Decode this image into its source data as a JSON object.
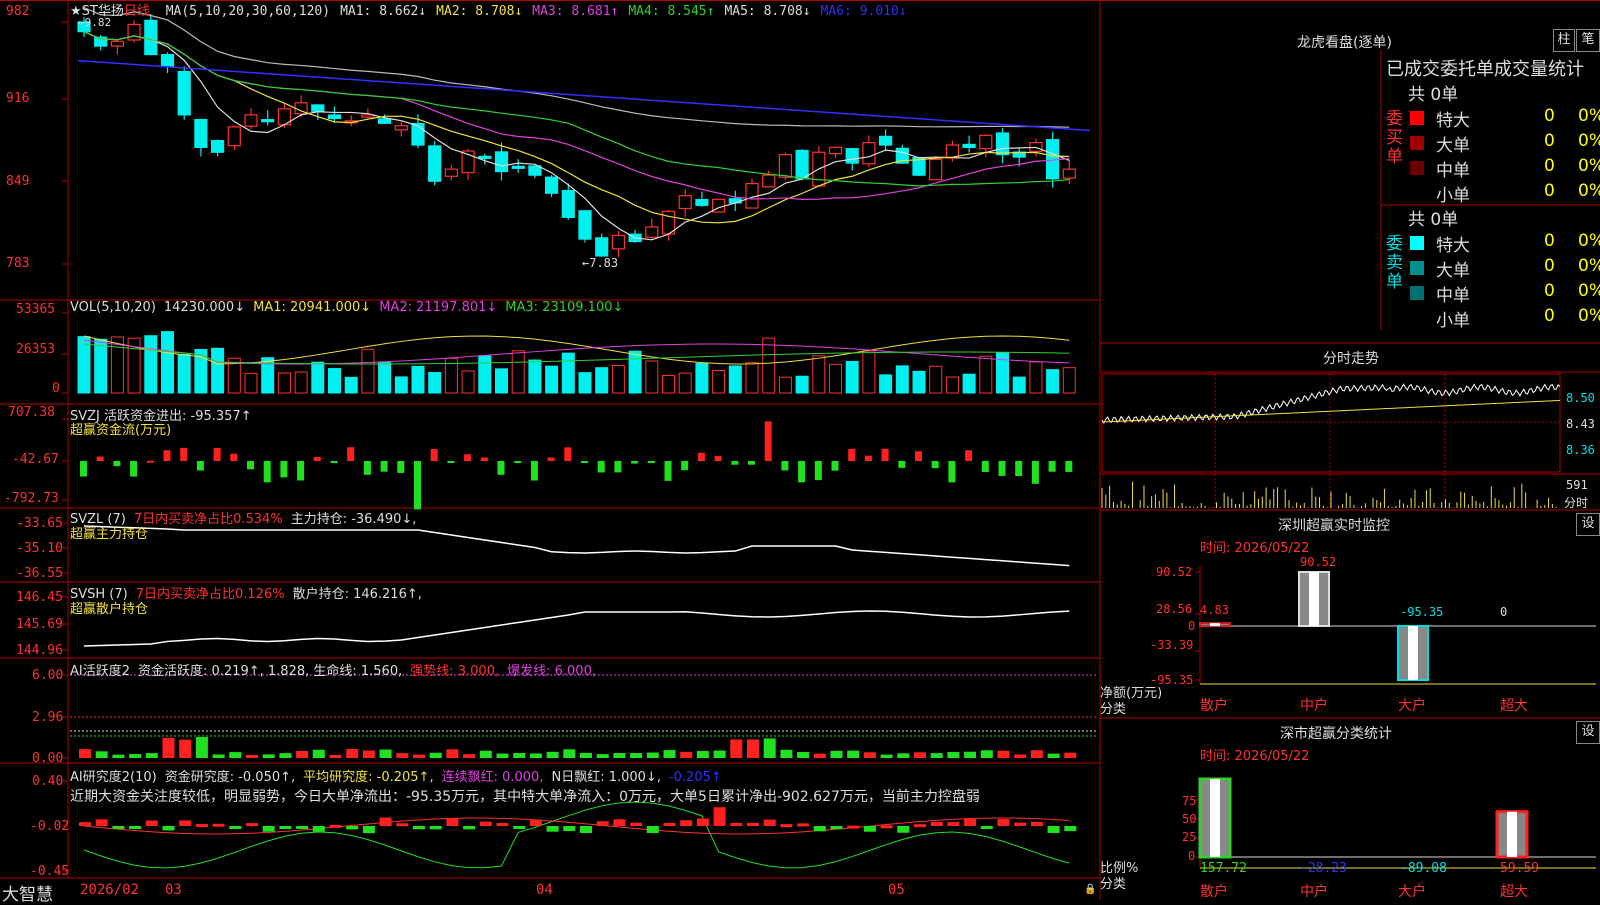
{
  "stock": {
    "name": "★ST华扬",
    "period": "日线"
  },
  "main": {
    "ma_labels": [
      {
        "text": "MA(5,10,20,30,60,120)",
        "color": "#dddddd"
      },
      {
        "text": "MA1: 8.662↓",
        "color": "#dddddd"
      },
      {
        "text": "MA2: 8.708↓",
        "color": "#f0e040"
      },
      {
        "text": "MA3: 8.681↑",
        "color": "#e040e0"
      },
      {
        "text": "MA4: 8.545↑",
        "color": "#30d030"
      },
      {
        "text": "MA5: 8.708↓",
        "color": "#dddddd"
      },
      {
        "text": "MA6: 9.010↓",
        "color": "#3030ff"
      }
    ],
    "y_ticks": [
      "982",
      "916",
      "849",
      "783"
    ],
    "high_label": "9.82",
    "low_label": "7.83"
  },
  "vol": {
    "labels": [
      {
        "text": "VOL(5,10,20)",
        "color": "#dddddd"
      },
      {
        "text": "14230.000↓",
        "color": "#dddddd"
      },
      {
        "text": "MA1: 20941.000↓",
        "color": "#f0e040"
      },
      {
        "text": "MA2: 21197.801↓",
        "color": "#e040e0"
      },
      {
        "text": "MA3: 23109.100↓",
        "color": "#30d030"
      }
    ],
    "y_ticks": [
      "53365",
      "26353",
      "0"
    ]
  },
  "svzj": {
    "labels": [
      {
        "text": "SVZJ  活跃资金进出: -95.357↑",
        "color": "#dddddd"
      }
    ],
    "subtitle": "超赢资金流(万元)",
    "y_ticks": [
      "707.38",
      "-42.67",
      "-792.73"
    ]
  },
  "svzl": {
    "labels": [
      {
        "text": "SVZL (7)",
        "color": "#dddddd"
      },
      {
        "text": "7日内买卖净占比0.534%",
        "color": "#ff3030"
      },
      {
        "text": "主力持仓: -36.490↓,",
        "color": "#dddddd"
      }
    ],
    "subtitle": "超赢主力持仓",
    "y_ticks": [
      "-33.65",
      "-35.10",
      "-36.55"
    ]
  },
  "svsh": {
    "labels": [
      {
        "text": "SVSH (7)",
        "color": "#dddddd"
      },
      {
        "text": "7日内买卖净占比0.126%",
        "color": "#ff3030"
      },
      {
        "text": "散户持仓: 146.216↑,",
        "color": "#dddddd"
      }
    ],
    "subtitle": "超赢散户持仓",
    "y_ticks": [
      "146.45",
      "145.69",
      "144.96"
    ]
  },
  "ai1": {
    "labels": [
      {
        "text": "AI活跃度2",
        "color": "#dddddd"
      },
      {
        "text": "资金活跃度: 0.219↑, 1.828, 生命线: 1.560,",
        "color": "#dddddd"
      },
      {
        "text": "强势线: 3.000,",
        "color": "#ff3030"
      },
      {
        "text": "爆发线: 6.000,",
        "color": "#e040e0"
      }
    ],
    "y_ticks": [
      "6.00",
      "2.96",
      "0.00"
    ]
  },
  "ai2": {
    "labels": [
      {
        "text": "AI研究度2(10)",
        "color": "#dddddd"
      },
      {
        "text": "资金研究度: -0.050↑,",
        "color": "#dddddd"
      },
      {
        "text": "平均研究度: -0.205↑,",
        "color": "#f0e040"
      },
      {
        "text": "连续飘红: 0.000,",
        "color": "#e040e0"
      },
      {
        "text": "N日飘红: 1.000↓,",
        "color": "#dddddd"
      },
      {
        "text": "-0.205↑",
        "color": "#3030ff"
      }
    ],
    "comment": "近期大资金关注度较低，明显弱势，今日大单净流出：-95.35万元，其中特大单净流入：0万元，大单5日累计净出-902.627万元，当前主力控盘弱",
    "y_ticks": [
      "0.40",
      "-0.02",
      "-0.45"
    ]
  },
  "bottom": {
    "brand": "大智慧",
    "dates": [
      "2026/02",
      "03",
      "04",
      "05"
    ]
  },
  "panel": {
    "title": "龙虎看盘(逐单)",
    "btn_zhu": "柱",
    "btn_bi": "笔",
    "header": "已成交委托单成交量统计",
    "buy": {
      "side": "委买单",
      "total": "共 0单",
      "rows": [
        {
          "label": "特大",
          "n": "0",
          "pct": "0%",
          "color": "#ff0000"
        },
        {
          "label": "大单",
          "n": "0",
          "pct": "0%",
          "color": "#a00000"
        },
        {
          "label": "中单",
          "n": "0",
          "pct": "0%",
          "color": "#700000"
        },
        {
          "label": "小单",
          "n": "0",
          "pct": "0%",
          "color": "#000000"
        }
      ]
    },
    "sell": {
      "side": "委卖单",
      "total": "共 0单",
      "rows": [
        {
          "label": "特大",
          "n": "0",
          "pct": "0%",
          "color": "#00ffff"
        },
        {
          "label": "大单",
          "n": "0",
          "pct": "0%",
          "color": "#008f8f"
        },
        {
          "label": "中单",
          "n": "0",
          "pct": "0%",
          "color": "#007070"
        },
        {
          "label": "小单",
          "n": "0",
          "pct": "0%",
          "color": "#000000"
        }
      ]
    }
  },
  "intraday": {
    "title": "分时走势",
    "prices": [
      "8.50",
      "8.43",
      "8.36"
    ],
    "vol_top": "591",
    "vol_unit": "分时"
  },
  "monitor": {
    "title": "深圳超赢实时监控",
    "btn": "设",
    "time": "时间: 2026/05/22",
    "y_ticks": [
      "90.52",
      "28.56",
      "0",
      "-33.39",
      "-95.35"
    ],
    "y_title": "净额(万元)",
    "x_title": "分类",
    "categories": [
      "散户",
      "中户",
      "大户",
      "超大"
    ],
    "values": [
      4.83,
      90.52,
      -95.35,
      0
    ],
    "value_labels": [
      "4.83",
      "90.52",
      "-95.35",
      "0"
    ]
  },
  "classify": {
    "title": "深市超赢分类统计",
    "btn": "设",
    "time": "时间: 2026/05/22",
    "y_ticks": [
      "75",
      "50",
      "25",
      "0"
    ],
    "y_title": "比例%",
    "x_title": "分类",
    "categories": [
      "散户",
      "中户",
      "大户",
      "超大"
    ],
    "values": [
      157.72,
      -28.23,
      -89.08,
      59.59
    ],
    "value_labels": [
      "157.72",
      "-28.23",
      "-89.08",
      "59.59"
    ]
  },
  "colors": {
    "up": "#ff3030",
    "down": "#00f0f0",
    "grid_red": "#b00000"
  },
  "chart_data": [
    {
      "type": "bar",
      "title": "深圳超赢实时监控",
      "ylabel": "净额(万元)",
      "xlabel": "分类",
      "categories": [
        "散户",
        "中户",
        "大户",
        "超大"
      ],
      "values": [
        4.83,
        90.52,
        -95.35,
        0
      ],
      "ylim": [
        -95.35,
        90.52
      ]
    },
    {
      "type": "bar",
      "title": "深市超赢分类统计",
      "ylabel": "比例%",
      "xlabel": "分类",
      "categories": [
        "散户",
        "中户",
        "大户",
        "超大"
      ],
      "values": [
        157.72,
        -28.23,
        -89.08,
        59.59
      ],
      "ylim": [
        0,
        75
      ]
    }
  ]
}
